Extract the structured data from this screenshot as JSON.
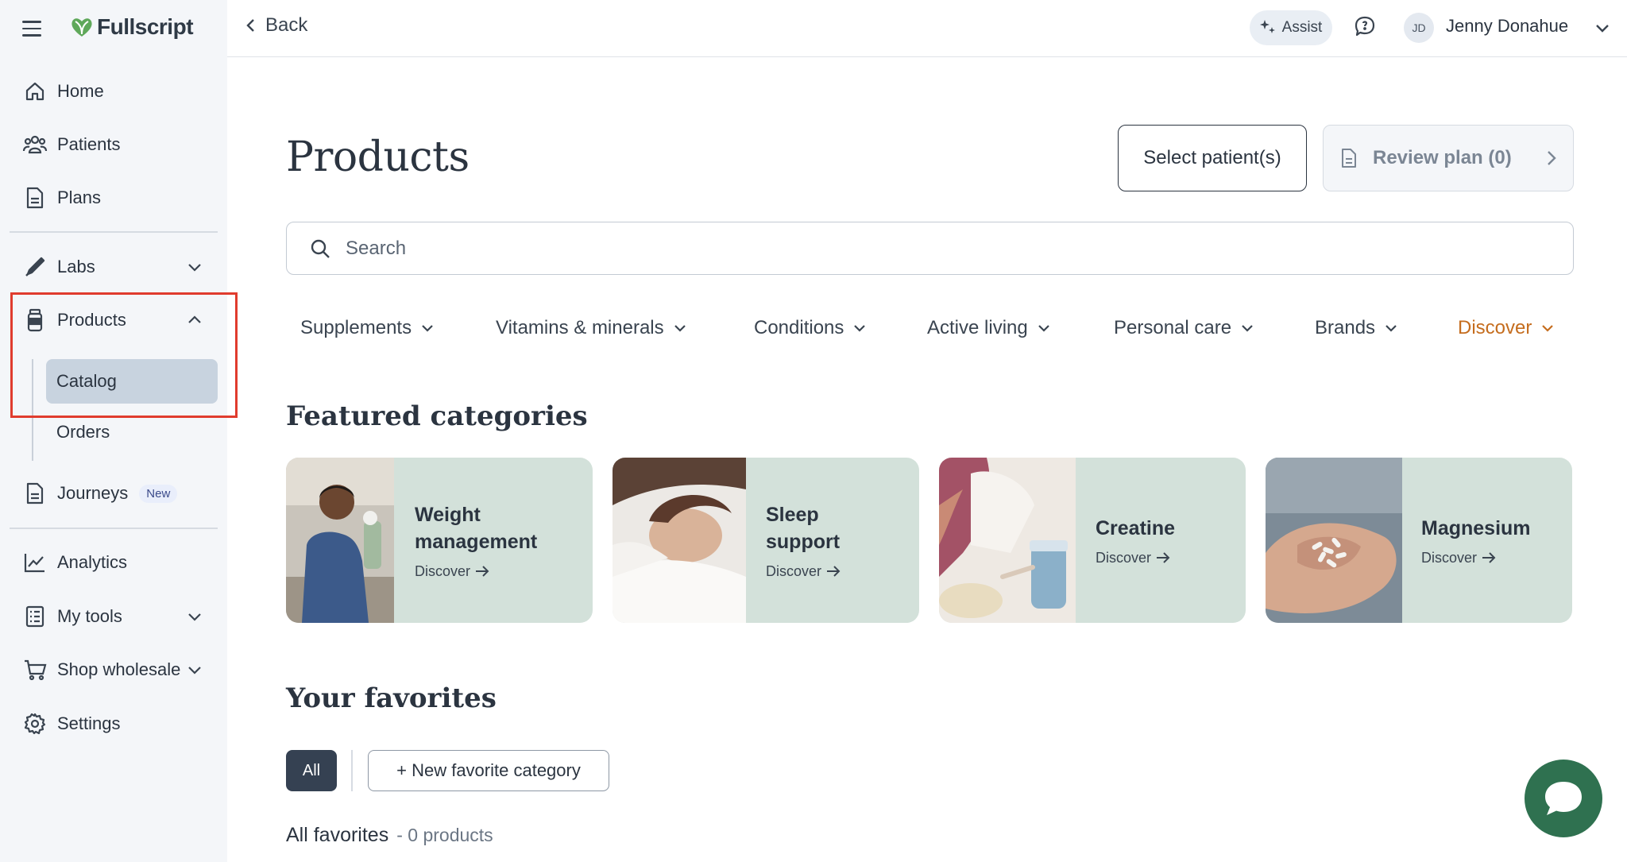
{
  "app": {
    "brand_name": "Fullscript",
    "brand_color": "#5fa85a"
  },
  "sidebar": {
    "items": [
      {
        "label": "Home",
        "icon": "home-icon"
      },
      {
        "label": "Patients",
        "icon": "patients-icon"
      },
      {
        "label": "Plans",
        "icon": "plans-icon"
      },
      {
        "label": "Labs",
        "icon": "labs-icon"
      },
      {
        "label": "Products",
        "icon": "products-icon"
      },
      {
        "label": "Journeys",
        "icon": "journeys-icon",
        "badge": "New"
      },
      {
        "label": "Analytics",
        "icon": "analytics-icon"
      },
      {
        "label": "My tools",
        "icon": "tools-icon"
      },
      {
        "label": "Shop wholesale",
        "icon": "cart-icon"
      },
      {
        "label": "Settings",
        "icon": "settings-icon"
      }
    ],
    "products_sub": [
      {
        "label": "Catalog",
        "active": true
      },
      {
        "label": "Orders",
        "active": false
      }
    ]
  },
  "topbar": {
    "back_label": "Back",
    "assist_label": "Assist",
    "user_initials": "JD",
    "user_name": "Jenny Donahue"
  },
  "main": {
    "title": "Products",
    "select_patients_label": "Select patient(s)",
    "review_plan_label": "Review plan (0)",
    "search_placeholder": "Search",
    "categories": [
      {
        "label": "Supplements"
      },
      {
        "label": "Vitamins & minerals"
      },
      {
        "label": "Conditions"
      },
      {
        "label": "Active living"
      },
      {
        "label": "Personal care"
      },
      {
        "label": "Brands"
      },
      {
        "label": "Discover",
        "color": "#c56d1e"
      }
    ],
    "featured_title": "Featured categories",
    "featured": [
      {
        "title_line1": "Weight",
        "title_line2": "management",
        "link": "Discover"
      },
      {
        "title_line1": "Sleep",
        "title_line2": "support",
        "link": "Discover"
      },
      {
        "title_line1": "Creatine",
        "title_line2": "",
        "link": "Discover"
      },
      {
        "title_line1": "Magnesium",
        "title_line2": "",
        "link": "Discover"
      }
    ],
    "favorites_title": "Your favorites",
    "filter_all": "All",
    "new_favorite_label": "+ New favorite category",
    "all_favorites_label": "All favorites",
    "all_favorites_count": "- 0 products"
  }
}
